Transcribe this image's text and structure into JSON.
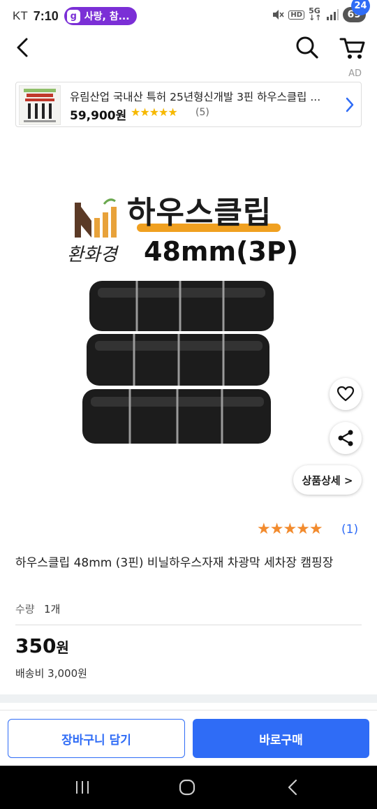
{
  "status_bar": {
    "carrier": "KT",
    "time": "7:10",
    "notification": "사랑, 참...",
    "notification_icon": "g",
    "battery": "69"
  },
  "header": {
    "cart_count": "24"
  },
  "ad": {
    "label": "AD",
    "title": "유림산업 국내산 특허 25년형신개발 3핀 하우스클립 ...",
    "price": "59,900원",
    "stars": "★★★★★",
    "review_count": "(5)"
  },
  "product_image": {
    "title": "하우스클립",
    "brand": "환화경",
    "size": "48mm(3P)"
  },
  "product_detail_button": "상품상세 >",
  "product": {
    "rating_stars": "★★★★★",
    "rating_count": "(1)",
    "name": "하우스클립 48mm (3핀) 비닐하우스자재 차광막 세차장 캠핑장",
    "quantity_label": "수량",
    "quantity_value": "1개",
    "price": "350",
    "price_unit": "원",
    "shipping": "배송비 3,000원"
  },
  "actions": {
    "add_to_cart": "장바구니 담기",
    "buy_now": "바로구매"
  },
  "colors": {
    "accent": "#2f6cf6",
    "star_orange": "#f28b2e",
    "star_yellow": "#f6b800",
    "highlight": "#f0a020"
  }
}
